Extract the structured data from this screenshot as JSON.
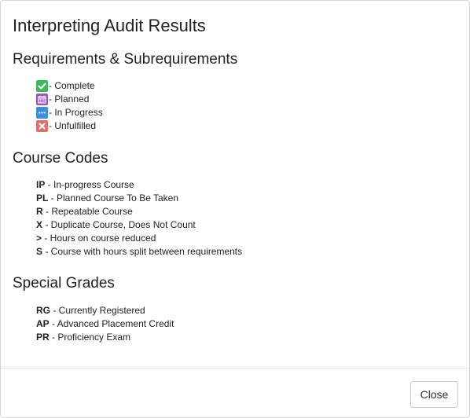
{
  "modal": {
    "title": "Interpreting Audit Results",
    "close_label": "Close"
  },
  "requirements": {
    "heading": "Requirements & Subrequirements",
    "items": [
      {
        "icon": "check-icon",
        "color": "#3cb95c",
        "label": "- Complete"
      },
      {
        "icon": "calendar-icon",
        "color": "#9b59b6",
        "label": "- Planned"
      },
      {
        "icon": "ellipsis-icon",
        "color": "#3a8fd6",
        "label": "- In Progress"
      },
      {
        "icon": "x-icon",
        "color": "#e0706a",
        "label": "- Unfulfilled"
      }
    ]
  },
  "course_codes": {
    "heading": "Course Codes",
    "items": [
      {
        "code": "IP",
        "desc": " - In-progress Course"
      },
      {
        "code": "PL",
        "desc": " - Planned Course To Be Taken"
      },
      {
        "code": "R",
        "desc": " - Repeatable Course"
      },
      {
        "code": "X",
        "desc": " - Duplicate Course, Does Not Count"
      },
      {
        "code": ">",
        "desc": " - Hours on course reduced"
      },
      {
        "code": "S",
        "desc": " - Course with hours split between requirements"
      }
    ]
  },
  "special_grades": {
    "heading": "Special Grades",
    "items": [
      {
        "code": "RG",
        "desc": " - Currently Registered"
      },
      {
        "code": "AP",
        "desc": " - Advanced Placement Credit"
      },
      {
        "code": "PR",
        "desc": " - Proficiency Exam"
      }
    ]
  }
}
